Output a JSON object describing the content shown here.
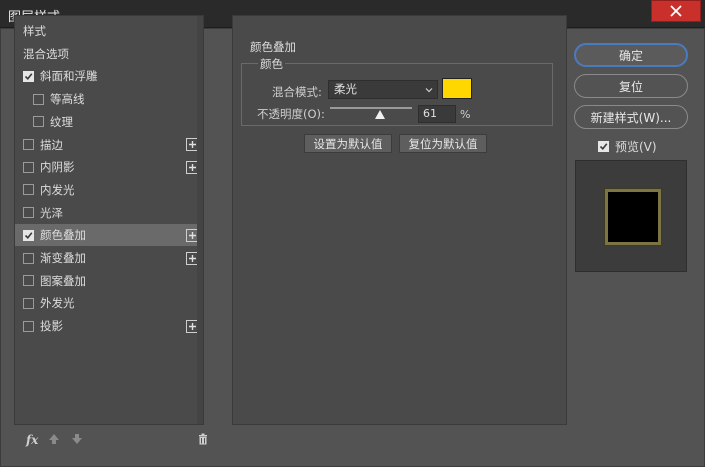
{
  "window": {
    "title": "图层样式"
  },
  "style_list": {
    "items": [
      {
        "label": "样式",
        "checkbox": false,
        "checked": false,
        "indent": 0,
        "plus": false,
        "selected": false
      },
      {
        "label": "混合选项",
        "checkbox": false,
        "checked": false,
        "indent": 0,
        "plus": false,
        "selected": false
      },
      {
        "label": "斜面和浮雕",
        "checkbox": true,
        "checked": true,
        "indent": 0,
        "plus": false,
        "selected": false
      },
      {
        "label": "等高线",
        "checkbox": true,
        "checked": false,
        "indent": 1,
        "plus": false,
        "selected": false
      },
      {
        "label": "纹理",
        "checkbox": true,
        "checked": false,
        "indent": 1,
        "plus": false,
        "selected": false
      },
      {
        "label": "描边",
        "checkbox": true,
        "checked": false,
        "indent": 0,
        "plus": true,
        "selected": false
      },
      {
        "label": "内阴影",
        "checkbox": true,
        "checked": false,
        "indent": 0,
        "plus": true,
        "selected": false
      },
      {
        "label": "内发光",
        "checkbox": true,
        "checked": false,
        "indent": 0,
        "plus": false,
        "selected": false
      },
      {
        "label": "光泽",
        "checkbox": true,
        "checked": false,
        "indent": 0,
        "plus": false,
        "selected": false
      },
      {
        "label": "颜色叠加",
        "checkbox": true,
        "checked": true,
        "indent": 0,
        "plus": true,
        "selected": true
      },
      {
        "label": "渐变叠加",
        "checkbox": true,
        "checked": false,
        "indent": 0,
        "plus": true,
        "selected": false
      },
      {
        "label": "图案叠加",
        "checkbox": true,
        "checked": false,
        "indent": 0,
        "plus": false,
        "selected": false
      },
      {
        "label": "外发光",
        "checkbox": true,
        "checked": false,
        "indent": 0,
        "plus": false,
        "selected": false
      },
      {
        "label": "投影",
        "checkbox": true,
        "checked": false,
        "indent": 0,
        "plus": true,
        "selected": false
      }
    ],
    "footer": {
      "fx_label": "fx"
    }
  },
  "color_overlay": {
    "section_title": "颜色叠加",
    "group_title": "颜色",
    "blend_mode_label": "混合模式:",
    "blend_mode_value": "柔光",
    "swatch_color": "#ffd700",
    "opacity_label": "不透明度(O):",
    "opacity_value": "61",
    "opacity_fraction": 0.61,
    "opacity_unit": "%",
    "set_default_label": "设置为默认值",
    "reset_default_label": "复位为默认值"
  },
  "actions": {
    "ok_label": "确定",
    "reset_label": "复位",
    "new_style_label": "新建样式(W)...",
    "preview_label": "预览(V)",
    "preview_checked": true
  },
  "colors": {
    "accent_border": "#4a7bc0",
    "close_button": "#c9302c",
    "preview_frame": "#7d7443"
  }
}
